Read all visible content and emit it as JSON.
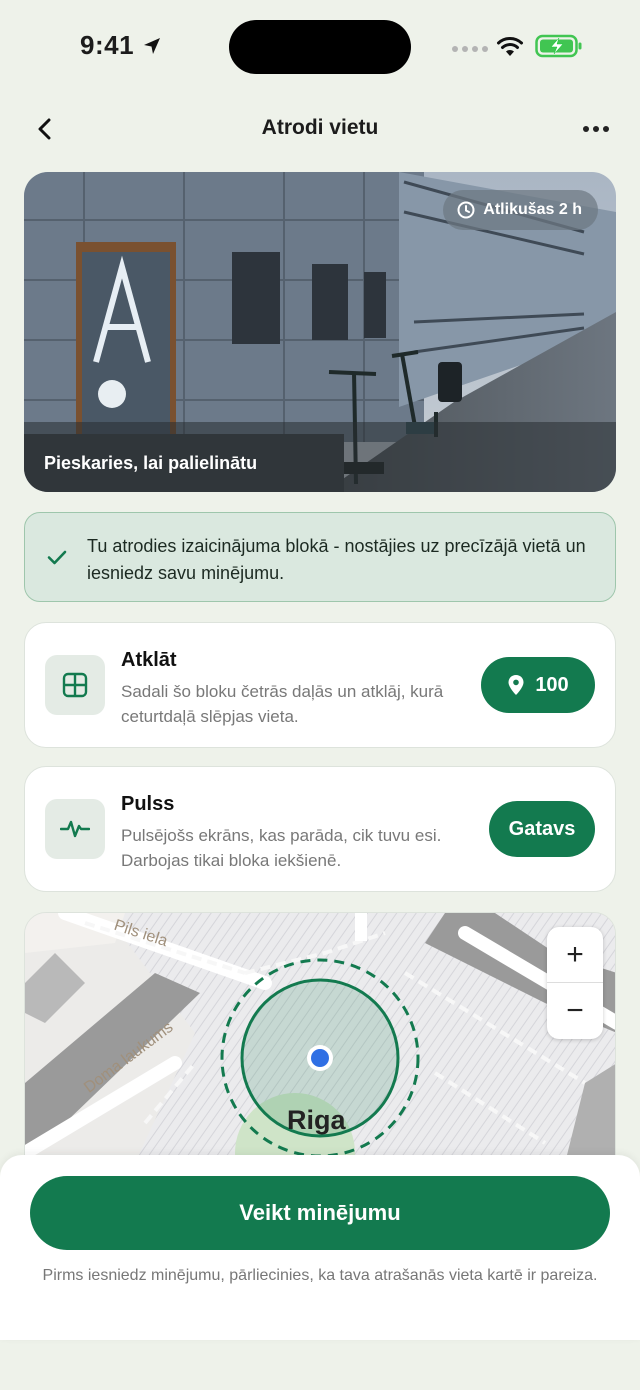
{
  "status_bar": {
    "time": "9:41",
    "icons": [
      "location-arrow-icon",
      "cellular-signal-icon",
      "wifi-icon",
      "battery-charging-icon"
    ]
  },
  "header": {
    "title": "Atrodi vietu",
    "back_icon": "chevron-left-icon",
    "more_icon": "more-horizontal-icon"
  },
  "photo": {
    "time_left": "Atlikušas 2 h",
    "caption": "Pieskaries, lai palielinātu",
    "clock_icon": "clock-icon"
  },
  "banner": {
    "text": "Tu atrodies izaicinājuma blokā - nostājies uz precīzājā vietā un iesniedz savu minējumu.",
    "icon": "check-icon"
  },
  "cards": {
    "reveal": {
      "title": "Atklāt",
      "description": "Sadali šo bloku četrās daļās un atklāj, kurā ceturtdaļā slēpjas vieta.",
      "button_label": "100",
      "icon": "grid-icon",
      "button_icon": "map-pin-icon"
    },
    "pulse": {
      "title": "Pulss",
      "description": "Pulsējošs ekrāns, kas parāda, cik tuvu esi. Darbojas tikai bloka iekšienē.",
      "button_label": "Gatavs",
      "icon": "pulse-icon"
    }
  },
  "map": {
    "streets": {
      "pils": "Pils iela",
      "doma": "Doma laukums"
    },
    "city": "Riga",
    "zoom_in": "+",
    "zoom_out": "−"
  },
  "bottom": {
    "submit_label": "Veikt minējumu",
    "footnote": "Pirms iesniedz minējumu, pārliecinies, ka tava atrašanās vieta kartē ir pareiza."
  },
  "colors": {
    "accent": "#137a4f",
    "background": "#eef2ea",
    "banner_bg": "#dae8df",
    "user_dot": "#2f6fe4"
  }
}
